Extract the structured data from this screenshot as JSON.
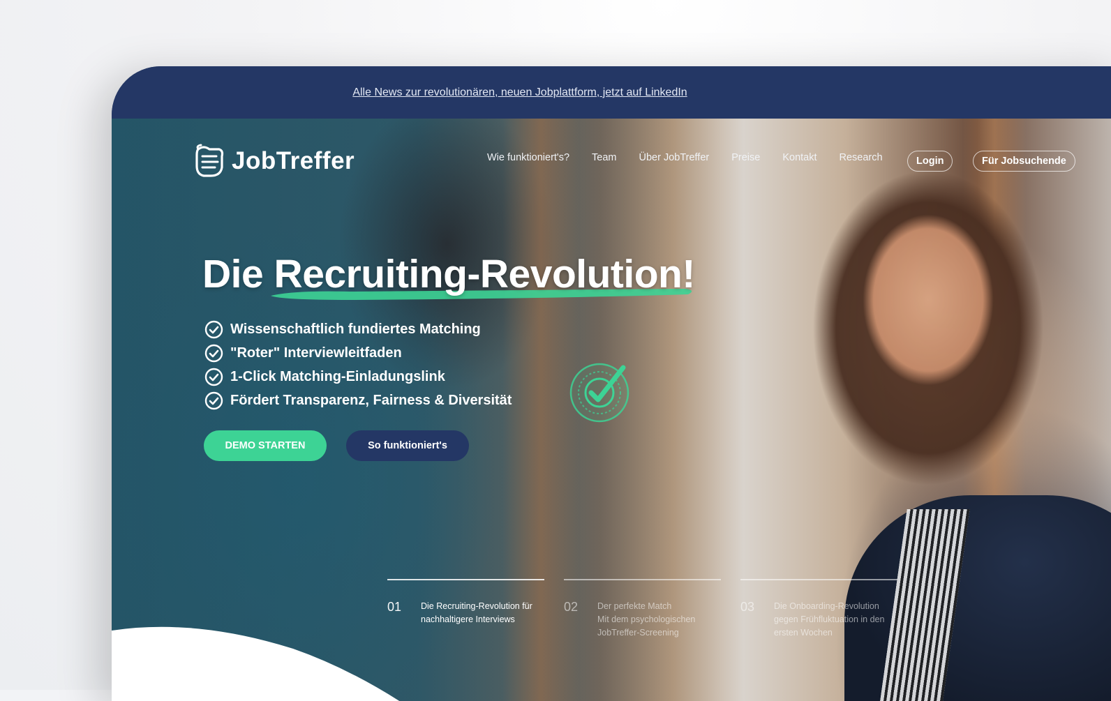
{
  "announcement": {
    "link_text": "Alle News zur revolutionären, neuen Jobplattform, jetzt auf LinkedIn"
  },
  "brand": {
    "name": "JobTreffer",
    "logo_icon": "handshake-icon"
  },
  "nav": {
    "items": [
      "Wie funktioniert's?",
      "Team",
      "Über JobTreffer",
      "Preise",
      "Kontakt",
      "Research"
    ],
    "login": "Login",
    "jobseekers": "Für Jobsuchende"
  },
  "hero": {
    "headline": "Die Recruiting-Revolution!",
    "features": [
      "Wissenschaftlich fundiertes Matching",
      "\"Roter\" Interviewleitfaden",
      "1-Click Matching-Einladungslink",
      "Fördert Transparenz, Fairness & Diversität"
    ],
    "demo_button": "DEMO STARTEN",
    "how_button": "So funktioniert's"
  },
  "steps": [
    {
      "num": "01",
      "lines": [
        "Die Recruiting-Revolution für",
        "nachhaltigere Interviews"
      ]
    },
    {
      "num": "02",
      "lines": [
        "Der perfekte Match",
        "Mit dem psychologischen",
        "JobTreffer-Screening"
      ]
    },
    {
      "num": "03",
      "lines": [
        "Die Onboarding-Revolution",
        "gegen Frühfluktuation in den",
        "ersten Wochen"
      ]
    }
  ],
  "colors": {
    "navy": "#243765",
    "green": "#3dd395",
    "white": "#ffffff"
  }
}
